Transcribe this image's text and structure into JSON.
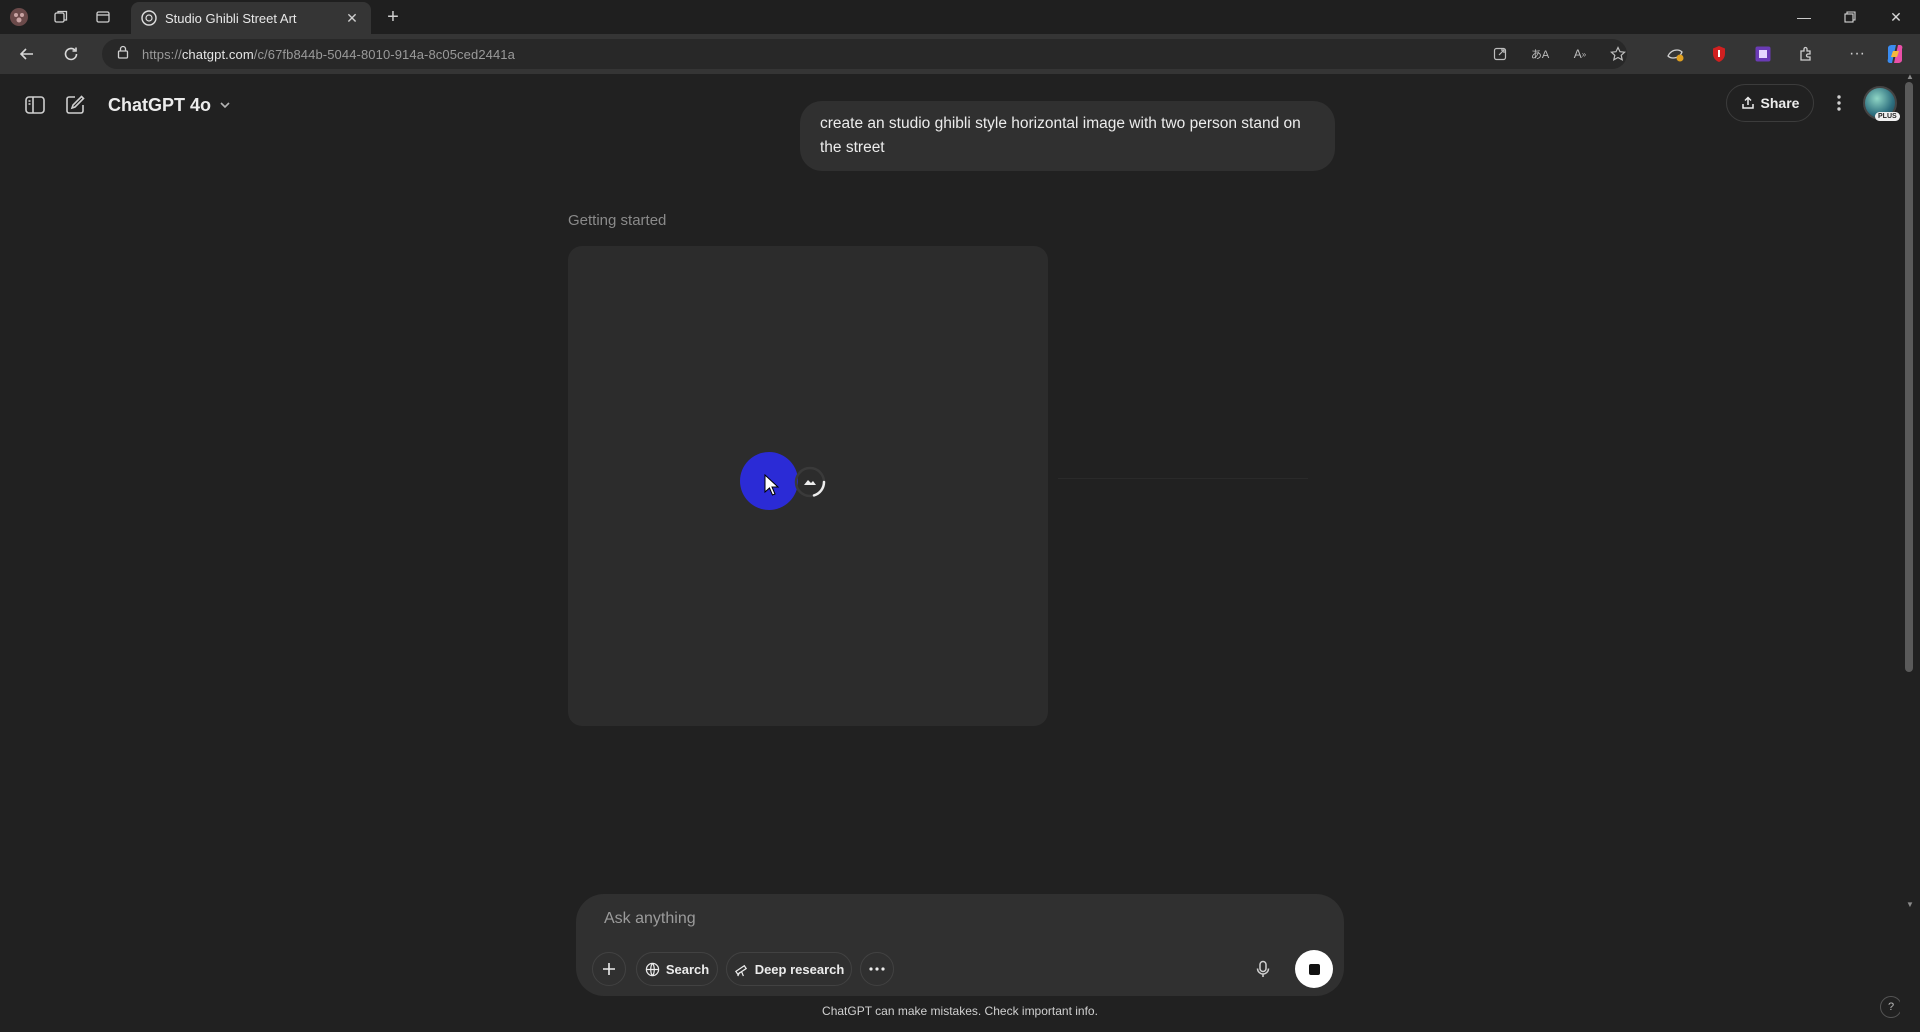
{
  "browser": {
    "tab_title": "Studio Ghibli Street Art",
    "url_prefix": "https://",
    "url_domain": "chatgpt.com",
    "url_path": "/c/67fb844b-5044-8010-914a-8c05ced2441a"
  },
  "header": {
    "model_label": "ChatGPT 4o",
    "share_label": "Share",
    "avatar_badge": "PLUS"
  },
  "conversation": {
    "user_message": "create an studio ghibli style horizontal image with two person stand on the street",
    "status": "Getting started"
  },
  "composer": {
    "placeholder": "Ask anything",
    "search_label": "Search",
    "deep_research_label": "Deep research",
    "disclaimer": "ChatGPT can make mistakes. Check important info."
  },
  "help": "?",
  "colors": {
    "page_bg": "#212121",
    "bubble_bg": "#303030",
    "cursor_highlight": "#2b2bd6"
  },
  "icons": [
    "profile-icon",
    "workspaces-icon",
    "tab-actions-icon",
    "chatgpt-favicon",
    "close-tab-icon",
    "new-tab-icon",
    "minimize-icon",
    "restore-icon",
    "close-window-icon",
    "back-icon",
    "refresh-icon",
    "lock-icon",
    "open-app-icon",
    "translate-icon",
    "read-aloud-icon",
    "favorite-icon",
    "collections-icon",
    "adblock-icon",
    "extension-icon",
    "extensions-icon",
    "more-icon",
    "copilot-icon",
    "sidebar-toggle-icon",
    "new-chat-icon",
    "share-icon",
    "kebab-icon",
    "plus-icon",
    "globe-icon",
    "telescope-icon",
    "ellipsis-icon",
    "mic-icon",
    "stop-icon",
    "image-loading-icon"
  ]
}
